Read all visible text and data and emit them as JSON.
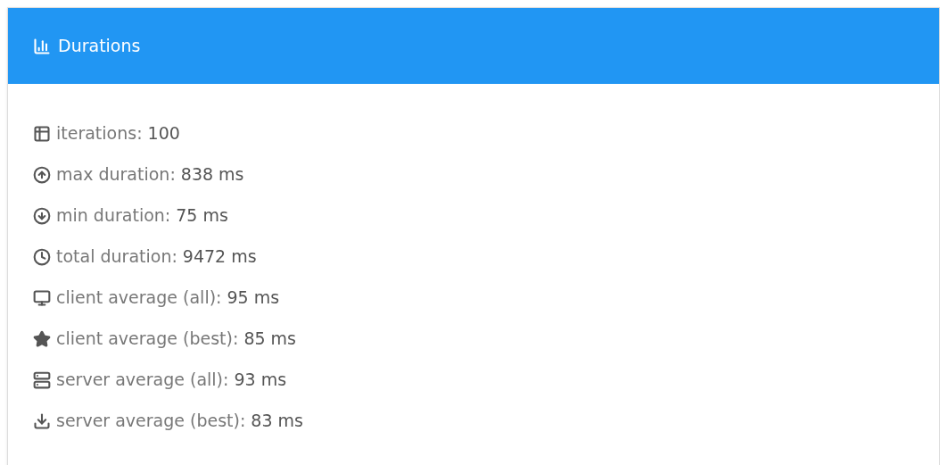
{
  "panel": {
    "title": "Durations"
  },
  "stats": [
    {
      "label": "iterations:",
      "value": "100"
    },
    {
      "label": "max duration:",
      "value": "838 ms"
    },
    {
      "label": "min duration:",
      "value": "75 ms"
    },
    {
      "label": "total duration:",
      "value": "9472 ms"
    },
    {
      "label": "client average (all):",
      "value": "95 ms"
    },
    {
      "label": "client average (best):",
      "value": "85 ms"
    },
    {
      "label": "server average (all):",
      "value": "93 ms"
    },
    {
      "label": "server average (best):",
      "value": "83 ms"
    }
  ]
}
